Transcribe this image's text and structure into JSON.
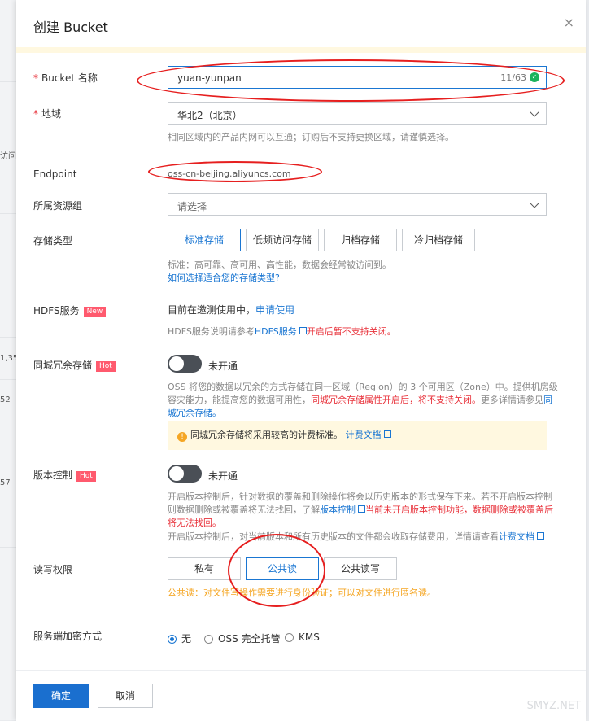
{
  "background": {
    "cells": [
      "访问",
      "1,35",
      "52",
      "57"
    ]
  },
  "dialog": {
    "title": "创建 Bucket",
    "close_icon": "×"
  },
  "form": {
    "bucket_name": {
      "label": "Bucket 名称",
      "value": "yuan-yunpan",
      "counter": "11/63"
    },
    "region": {
      "label": "地域",
      "value": "华北2（北京）",
      "hint": "相同区域内的产品内网可以互通；订购后不支持更换区域，请谨慎选择。"
    },
    "endpoint": {
      "label": "Endpoint",
      "value": "oss-cn-beijing.aliyuncs.com"
    },
    "resource_group": {
      "label": "所属资源组",
      "placeholder": "请选择"
    },
    "storage_class": {
      "label": "存储类型",
      "options": [
        "标准存储",
        "低频访问存储",
        "归档存储",
        "冷归档存储"
      ],
      "selected": "标准存储",
      "hint": "标准：高可靠、高可用、高性能，数据会经常被访问到。",
      "help_link": "如何选择适合您的存储类型?"
    },
    "hdfs": {
      "label": "HDFS服务",
      "badge": "New",
      "status": "目前在邀测使用中，",
      "apply_link": "申请使用",
      "hint_prefix": "HDFS服务说明请参考",
      "hint_link": "HDFS服务",
      "hint_warn": "开启后暂不支持关闭。"
    },
    "zone_redundancy": {
      "label": "同城冗余存储",
      "badge": "Hot",
      "toggle_label": "未开通",
      "desc_1": "OSS 将您的数据以冗余的方式存储在同一区域（Region）的 3 个可用区（Zone）中。提供机房级容灾能力，能提高您的数据可用性，",
      "desc_warn": "同城冗余存储属性开启后，将不支持关闭。",
      "desc_2": "更多详情请参见",
      "desc_link": "同城冗余存储。",
      "notice_text": "同城冗余存储将采用较高的计费标准。",
      "notice_link": "计费文档"
    },
    "versioning": {
      "label": "版本控制",
      "badge": "Hot",
      "toggle_label": "未开通",
      "desc_1": "开启版本控制后，针对数据的覆盖和删除操作将会以历史版本的形式保存下来。若不开启版本控制则数据删除或被覆盖将无法找回，了解",
      "desc_link": "版本控制",
      "desc_warn": "当前未开启版本控制功能，数据删除或被覆盖后将无法找回。",
      "desc_3": "开启版本控制后，对当前版本和所有历史版本的文件都会收取存储费用，详情请查看",
      "desc_link2": "计费文档"
    },
    "acl": {
      "label": "读写权限",
      "options": [
        "私有",
        "公共读",
        "公共读写"
      ],
      "selected": "公共读",
      "warning": "公共读：对文件写操作需要进行身份验证；可以对文件进行匿名读。"
    },
    "encryption": {
      "label": "服务端加密方式",
      "options": [
        "无",
        "OSS 完全托管",
        "KMS"
      ],
      "selected": "无"
    }
  },
  "footer": {
    "confirm": "确定",
    "cancel": "取消"
  },
  "watermark": "SMYZ.NET"
}
